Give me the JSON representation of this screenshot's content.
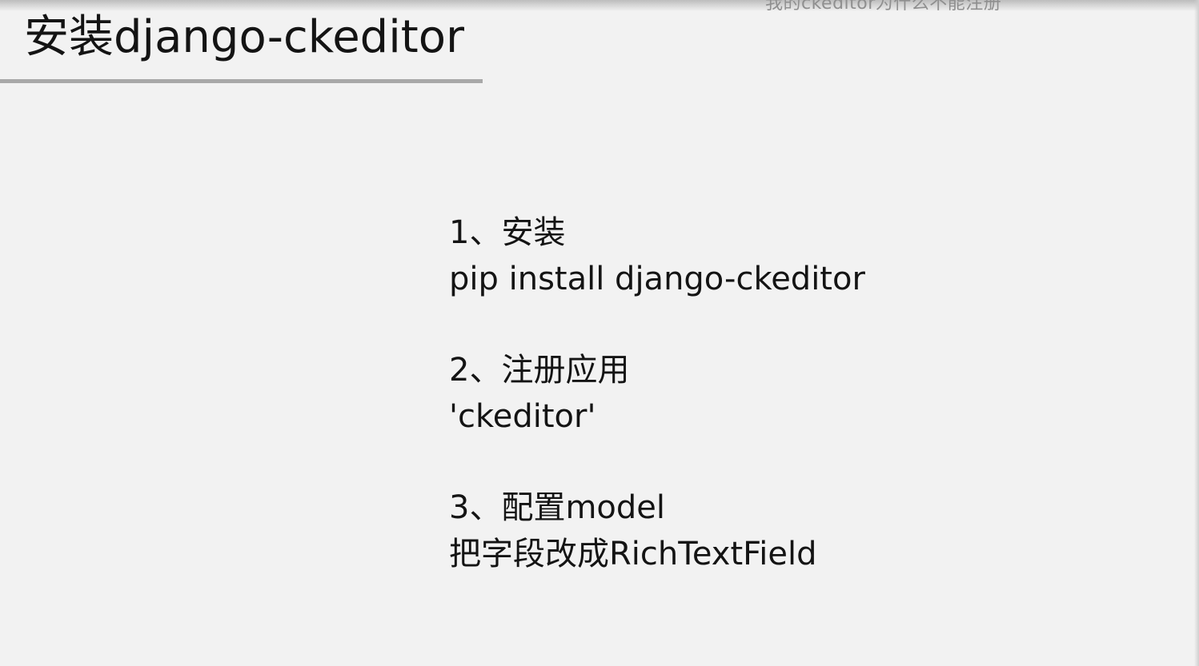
{
  "overlay_caption": "我的ckeditor为什么不能注册",
  "slide": {
    "title": "安装django-ckeditor",
    "steps": [
      {
        "heading": "1、安装",
        "detail": "pip install django-ckeditor"
      },
      {
        "heading": "2、注册应用",
        "detail": "'ckeditor'"
      },
      {
        "heading": "3、配置model",
        "detail": "把字段改成RichTextField"
      }
    ]
  }
}
